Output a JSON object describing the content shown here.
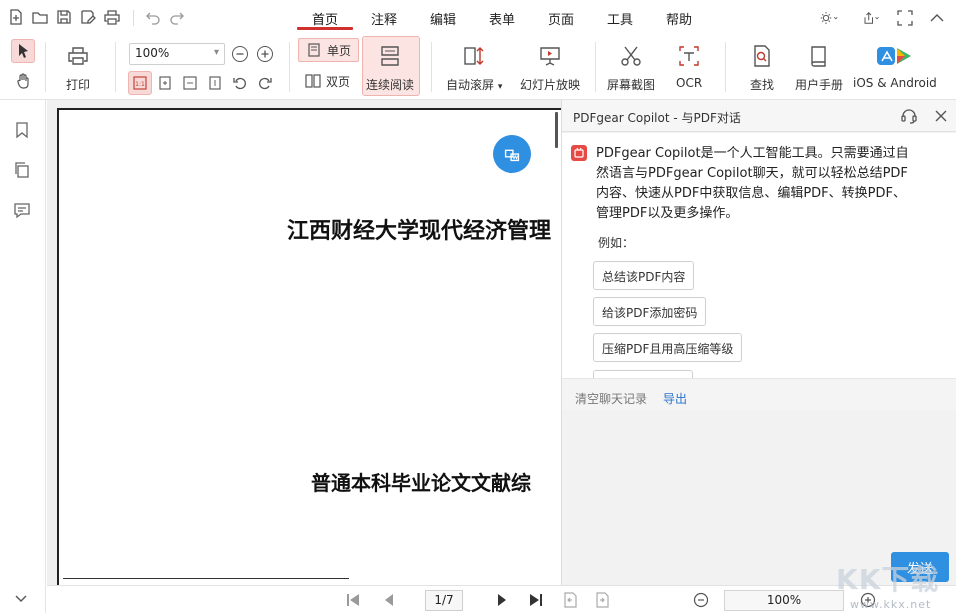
{
  "menu": {
    "tabs": [
      "首页",
      "注释",
      "编辑",
      "表单",
      "页面",
      "工具",
      "帮助"
    ],
    "active_tab": "首页"
  },
  "ribbon": {
    "print_label": "打印",
    "zoom_value": "100%",
    "single_page_label": "单页",
    "double_page_label": "双页",
    "continuous_label": "连续阅读",
    "auto_scroll_label": "自动滚屏",
    "slideshow_label": "幻灯片放映",
    "screenshot_label": "屏幕截图",
    "ocr_label": "OCR",
    "find_label": "查找",
    "manual_label": "用户手册",
    "mobile_label": "iOS & Android"
  },
  "document": {
    "title_line1": "江西财经大学现代经济管理",
    "title_line2": "普通本科毕业论文文献综"
  },
  "copilot": {
    "header_title": "PDFgear Copilot - 与PDF对话",
    "message_lines": [
      "PDFgear Copilot是一个人工智能工具。只需要通过自",
      "然语言与PDFgear Copilot聊天，就可以轻松总结PDF",
      "内容、快速从PDF中获取信息、编辑PDF、转换PDF、",
      "管理PDF以及更多操作。"
    ],
    "examples_label": "例如：",
    "examples": [
      "总结该PDF内容",
      "给该PDF添加密码",
      "压缩PDF且用高压缩等级"
    ],
    "clear_label": "清空聊天记录",
    "export_label": "导出",
    "send_label": "发送"
  },
  "navigation": {
    "page_indicator": "1/7",
    "zoom_value": "100%"
  },
  "watermark": {
    "text": "KK下载",
    "url": "www.kkx.net"
  },
  "colors": {
    "accent_red": "#d1312e",
    "accent_blue": "#2f8fe0",
    "active_bg": "#fbe4e2"
  }
}
